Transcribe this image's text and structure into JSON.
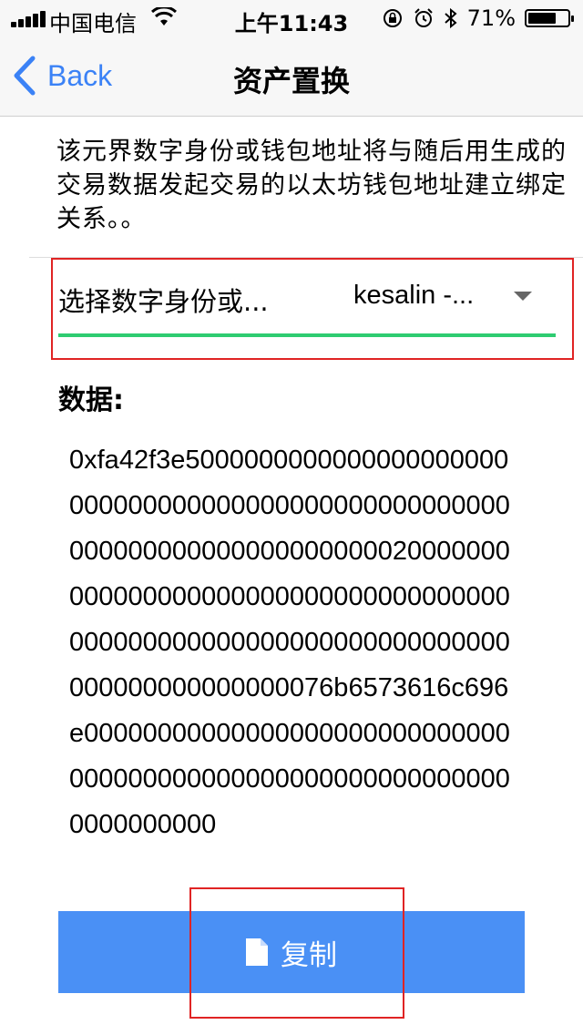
{
  "status_bar": {
    "carrier": "中国电信",
    "time": "上午11:43",
    "battery_percent": "71%",
    "battery_level": 0.71
  },
  "nav": {
    "back_label": "Back",
    "title": "资产置换"
  },
  "description": "该元界数字身份或钱包地址将与随后用生成的交易数据发起交易的以太坊钱包地址建立绑定关系。。",
  "selector": {
    "label": "选择数字身份或...",
    "value": "kesalin -..."
  },
  "data_section": {
    "label": "数据:",
    "value": "0xfa42f3e5000000000000000000000000000000000000000000000000000000000000000000000000020000000000000000000000000000000000000000000000000000000000000000000000000000000000076b6573616c696e000000000000000000000000000000000000000000000000000000000000000000000"
  },
  "copy_button": {
    "label": "复制",
    "icon": "file-icon"
  },
  "colors": {
    "accent": "#3b82f6",
    "button": "#4a90f5",
    "underline": "#2ecc71",
    "highlight": "#e02424"
  }
}
